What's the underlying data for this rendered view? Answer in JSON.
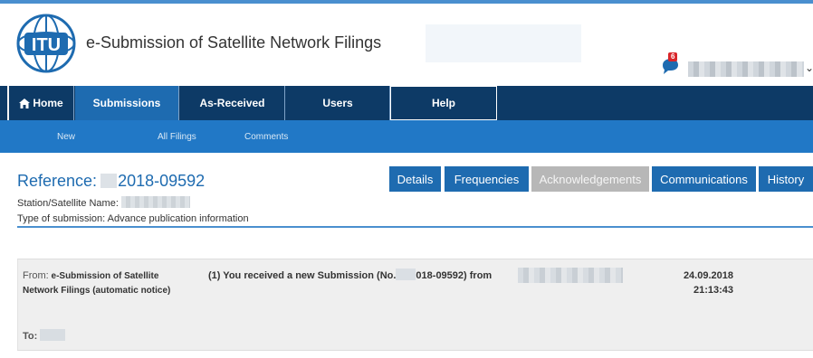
{
  "header": {
    "logo_text": "ITU",
    "app_title": "e-Submission of Satellite Network Filings",
    "notification_count": "6"
  },
  "nav": {
    "items": [
      {
        "label": "Home",
        "icon": "home-icon"
      },
      {
        "label": "Submissions"
      },
      {
        "label": "As-Received"
      },
      {
        "label": "Users"
      },
      {
        "label": "Help"
      }
    ]
  },
  "subnav": {
    "items": [
      {
        "label": "New"
      },
      {
        "label": "All Filings"
      },
      {
        "label": "Comments"
      }
    ]
  },
  "reference": {
    "label": "Reference:",
    "number": "2018-09592",
    "station_label": "Station/Satellite Name:",
    "submission_type": "Type of submission: Advance publication information"
  },
  "tabs": [
    {
      "label": "Details"
    },
    {
      "label": "Frequencies"
    },
    {
      "label": "Acknowledgements"
    },
    {
      "label": "Communications"
    },
    {
      "label": "History"
    }
  ],
  "message": {
    "from_label": "From:",
    "from_value": "e-Submission of Satellite Network Filings (automatic notice)",
    "subject_prefix": "(1) You received a new Submission (No.",
    "subject_suffix": "018-09592) from",
    "date": "24.09.2018",
    "time": "21:13:43",
    "to_label": "To:"
  },
  "colors": {
    "nav_bg": "#0d3a66",
    "accent": "#1e6bb0",
    "subnav_bg": "#2178c6",
    "badge": "#d9262a"
  }
}
